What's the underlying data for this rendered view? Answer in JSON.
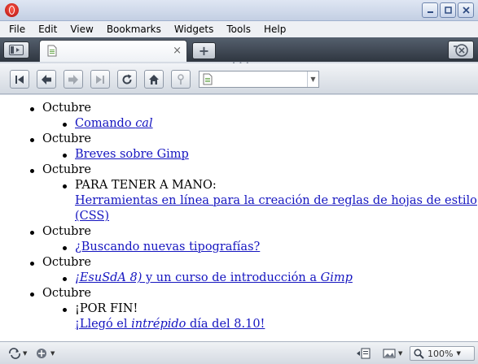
{
  "menubar": {
    "items": [
      "File",
      "Edit",
      "View",
      "Bookmarks",
      "Widgets",
      "Tools",
      "Help"
    ]
  },
  "tab": {
    "close_glyph": "×"
  },
  "newtab": {
    "glyph": "+"
  },
  "content": {
    "sections": [
      {
        "month": "Octubre",
        "entries": [
          {
            "link_pre": "Comando ",
            "link_italic": "cal",
            "link_post": ""
          }
        ]
      },
      {
        "month": "Octubre",
        "entries": [
          {
            "link_pre": "Breves sobre Gimp",
            "link_italic": "",
            "link_post": ""
          }
        ]
      },
      {
        "month": "Octubre",
        "entries": [
          {
            "text": "PARA TENER A MANO:",
            "link_pre": "Herramientas en línea para la creación de reglas de hojas de estilo (CSS)",
            "link_italic": "",
            "link_post": ""
          }
        ]
      },
      {
        "month": "Octubre",
        "entries": [
          {
            "link_pre": "¿Buscando nuevas tipografías?",
            "link_italic": "",
            "link_post": ""
          }
        ]
      },
      {
        "month": "Octubre",
        "entries": [
          {
            "link_italic_first": "¡EsuSdA 8)",
            "link_pre": " y un curso de introducción a ",
            "link_italic": "Gimp",
            "link_post": ""
          }
        ]
      },
      {
        "month": "Octubre",
        "entries": [
          {
            "text": "¡POR FIN!",
            "link_pre": "¡Llegó el ",
            "link_italic": "intrépido",
            "link_post": " día del 8.10!"
          }
        ]
      }
    ]
  },
  "statusbar": {
    "zoom": "100%"
  }
}
